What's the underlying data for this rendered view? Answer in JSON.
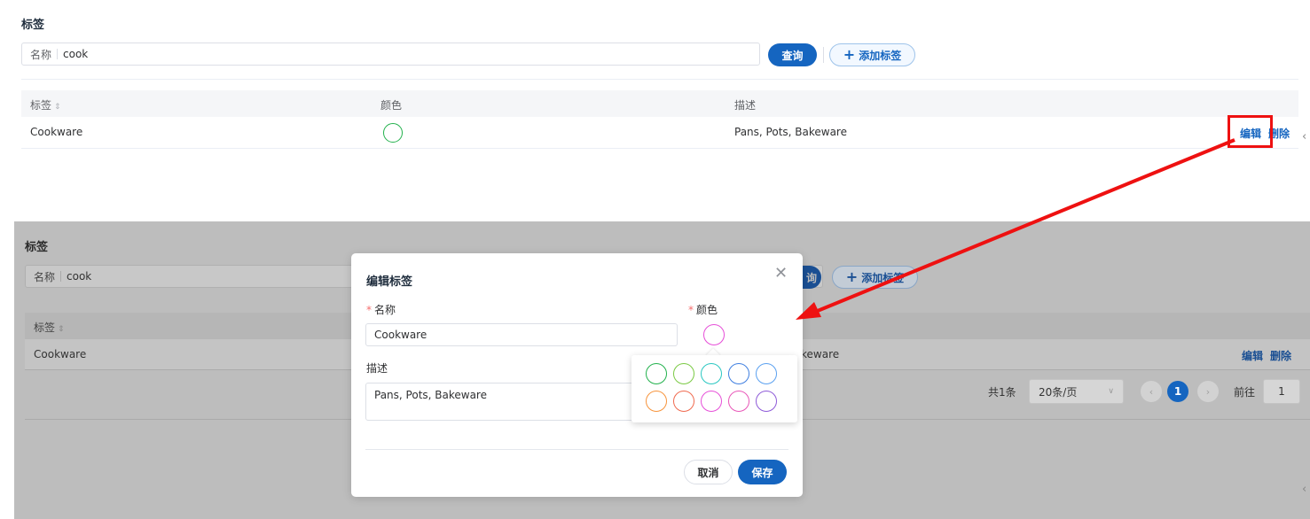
{
  "top": {
    "title": "标签",
    "search": {
      "label": "名称",
      "value": "cook"
    },
    "query_label": "查询",
    "add_label": "添加标签",
    "columns": [
      "标签",
      "颜色",
      "描述"
    ],
    "row": {
      "name": "Cookware",
      "color": "#22b14c",
      "description": "Pans, Pots, Bakeware",
      "edit": "编辑",
      "delete": "删除"
    }
  },
  "bottom": {
    "title": "标签",
    "search": {
      "label": "名称",
      "value": "cook"
    },
    "query_partial": "询",
    "add_label": "添加标签",
    "column_tag": "标签",
    "row": {
      "name": "Cookware",
      "description_partial": "keware",
      "edit": "编辑",
      "delete": "删除"
    },
    "pagination": {
      "total": "共1条",
      "page_size": "20条/页",
      "current_page": "1",
      "goto_label": "前往",
      "goto_value": "1"
    }
  },
  "dialog": {
    "title": "编辑标签",
    "name_label": "名称",
    "name_value": "Cookware",
    "color_label": "颜色",
    "selected_color": "#e64fd8",
    "desc_label": "描述",
    "desc_value": "Pans, Pots, Bakeware",
    "cancel_label": "取消",
    "save_label": "保存",
    "palette": [
      "#22b14c",
      "#7ac943",
      "#29c7c1",
      "#3f7fe0",
      "#5aa0f0",
      "#f7943c",
      "#f06a4f",
      "#e64fd8",
      "#e857b8",
      "#8e5ad8"
    ]
  },
  "colors": {
    "primary": "#1565c0",
    "annotation": "#ee1111"
  }
}
